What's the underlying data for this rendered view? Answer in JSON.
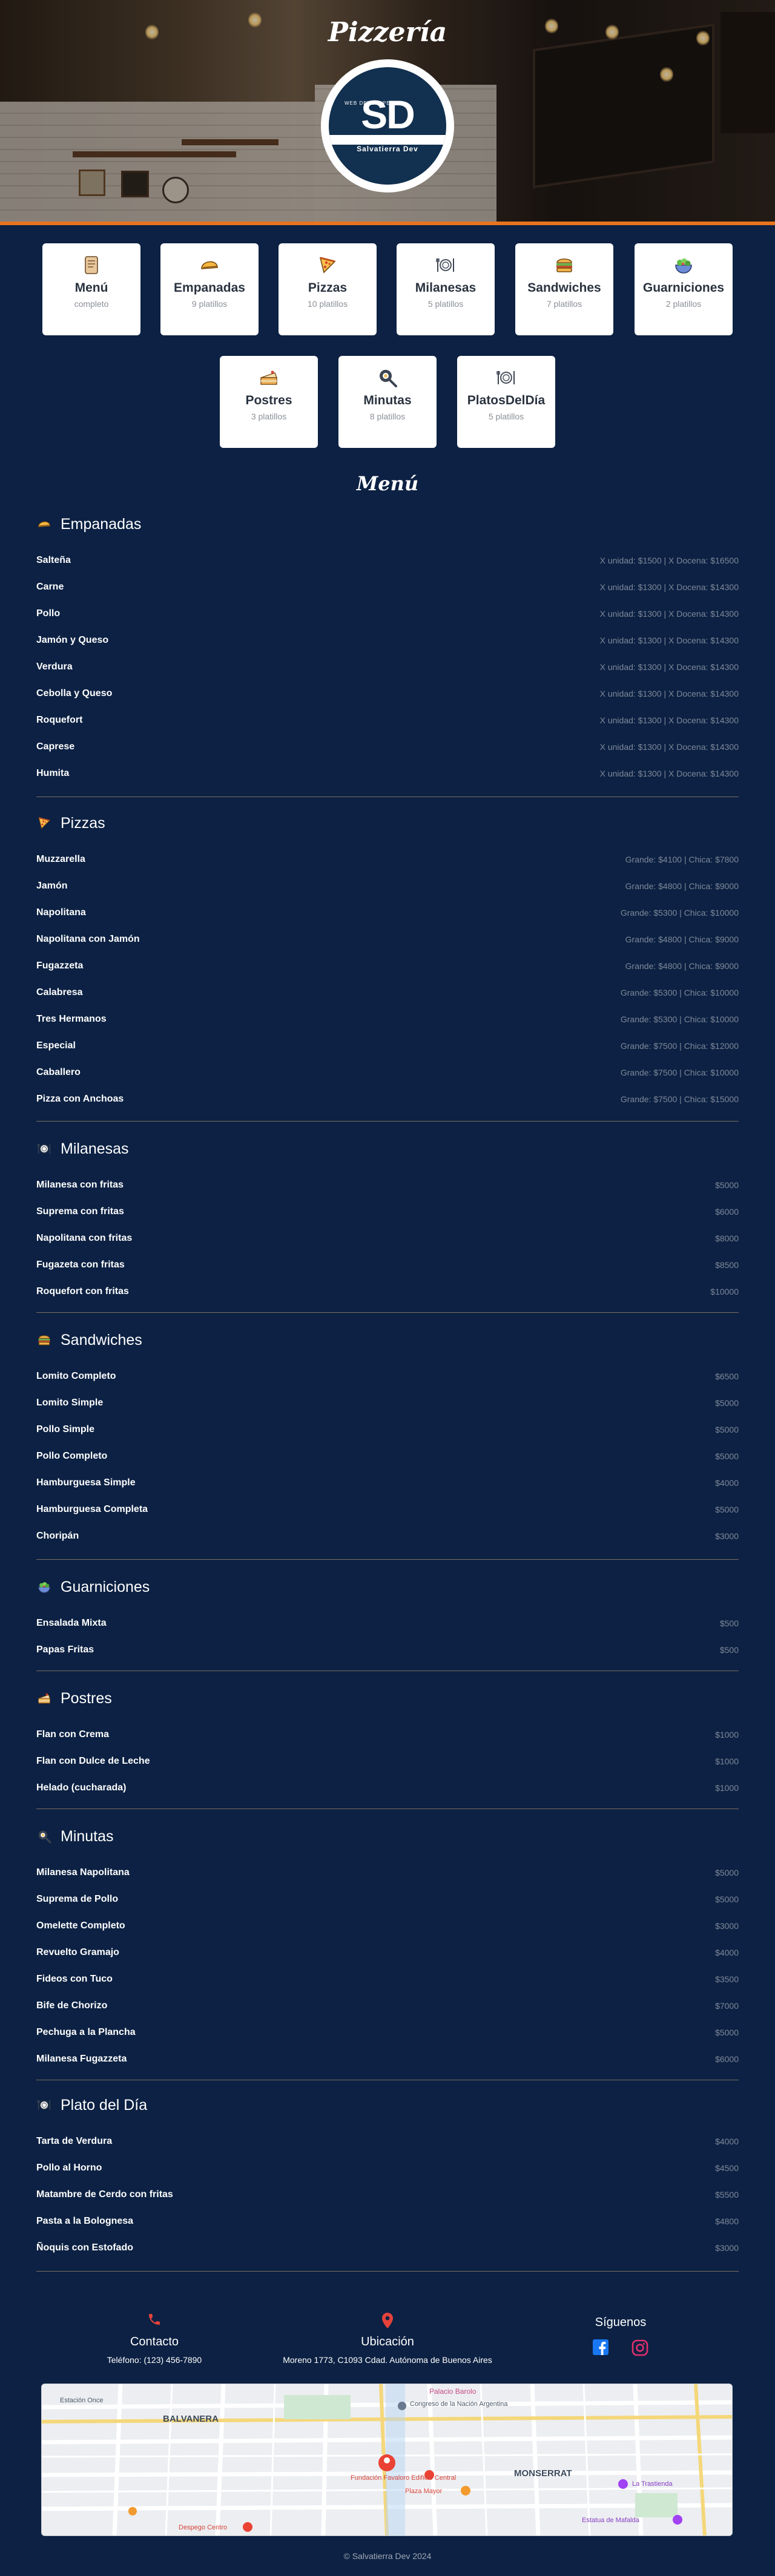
{
  "hero": {
    "title": "Pizzería"
  },
  "logo": {
    "initials": "SD",
    "tagline": "WEB DEVELOPER",
    "brand": "Salvatierra Dev"
  },
  "categories": [
    {
      "name": "Menú",
      "count": "completo",
      "icon": "scroll-icon"
    },
    {
      "name": "Empanadas",
      "count": "9 platillos",
      "icon": "empanada-icon"
    },
    {
      "name": "Pizzas",
      "count": "10 platillos",
      "icon": "pizza-icon"
    },
    {
      "name": "Milanesas",
      "count": "5 platillos",
      "icon": "plate-cutlery-icon"
    },
    {
      "name": "Sandwiches",
      "count": "7 platillos",
      "icon": "sandwich-icon"
    },
    {
      "name": "Guarniciones",
      "count": "2 platillos",
      "icon": "salad-icon"
    },
    {
      "name": "Postres",
      "count": "3 platillos",
      "icon": "cake-icon"
    },
    {
      "name": "Minutas",
      "count": "8 platillos",
      "icon": "pan-icon"
    },
    {
      "name": "PlatosDelDía",
      "count": "5 platillos",
      "icon": "plate-cutlery-icon"
    }
  ],
  "menu": {
    "title": "Menú",
    "sections": [
      {
        "title": "Empanadas",
        "icon": "empanada-icon",
        "items": [
          {
            "name": "Salteña",
            "price": "X unidad: $1500 | X Docena: $16500"
          },
          {
            "name": "Carne",
            "price": "X unidad: $1300 | X Docena: $14300"
          },
          {
            "name": "Pollo",
            "price": "X unidad: $1300 | X Docena: $14300"
          },
          {
            "name": "Jamón y Queso",
            "price": "X unidad: $1300 | X Docena: $14300"
          },
          {
            "name": "Verdura",
            "price": "X unidad: $1300 | X Docena: $14300"
          },
          {
            "name": "Cebolla y Queso",
            "price": "X unidad: $1300 | X Docena: $14300"
          },
          {
            "name": "Roquefort",
            "price": "X unidad: $1300 | X Docena: $14300"
          },
          {
            "name": "Caprese",
            "price": "X unidad: $1300 | X Docena: $14300"
          },
          {
            "name": "Humita",
            "price": "X unidad: $1300 | X Docena: $14300"
          }
        ]
      },
      {
        "title": "Pizzas",
        "icon": "pizza-icon",
        "items": [
          {
            "name": "Muzzarella",
            "price": "Grande: $4100 | Chica: $7800"
          },
          {
            "name": "Jamón",
            "price": "Grande: $4800 | Chica: $9000"
          },
          {
            "name": "Napolitana",
            "price": "Grande: $5300 | Chica: $10000"
          },
          {
            "name": "Napolitana con Jamón",
            "price": "Grande: $4800 | Chica: $9000"
          },
          {
            "name": "Fugazzeta",
            "price": "Grande: $4800 | Chica: $9000"
          },
          {
            "name": "Calabresa",
            "price": "Grande: $5300 | Chica: $10000"
          },
          {
            "name": "Tres Hermanos",
            "price": "Grande: $5300 | Chica: $10000"
          },
          {
            "name": "Especial",
            "price": "Grande: $7500 | Chica: $12000"
          },
          {
            "name": "Caballero",
            "price": "Grande: $7500 | Chica: $10000"
          },
          {
            "name": "Pizza con Anchoas",
            "price": "Grande: $7500 | Chica: $15000"
          }
        ]
      },
      {
        "title": "Milanesas",
        "icon": "plate-cutlery-icon",
        "items": [
          {
            "name": "Milanesa con fritas",
            "price": "$5000"
          },
          {
            "name": "Suprema con fritas",
            "price": "$6000"
          },
          {
            "name": "Napolitana con fritas",
            "price": "$8000"
          },
          {
            "name": "Fugazeta con fritas",
            "price": "$8500"
          },
          {
            "name": "Roquefort con fritas",
            "price": "$10000"
          }
        ]
      },
      {
        "title": "Sandwiches",
        "icon": "sandwich-icon",
        "items": [
          {
            "name": "Lomito Completo",
            "price": "$6500"
          },
          {
            "name": "Lomito Simple",
            "price": "$5000"
          },
          {
            "name": "Pollo Simple",
            "price": "$5000"
          },
          {
            "name": "Pollo Completo",
            "price": "$5000"
          },
          {
            "name": "Hamburguesa Simple",
            "price": "$4000"
          },
          {
            "name": "Hamburguesa Completa",
            "price": "$5000"
          },
          {
            "name": "Choripán",
            "price": "$3000"
          }
        ]
      },
      {
        "title": "Guarniciones",
        "icon": "salad-icon",
        "items": [
          {
            "name": "Ensalada Mixta",
            "price": "$500"
          },
          {
            "name": "Papas Fritas",
            "price": "$500"
          }
        ]
      },
      {
        "title": "Postres",
        "icon": "cake-icon",
        "items": [
          {
            "name": "Flan con Crema",
            "price": "$1000"
          },
          {
            "name": "Flan con Dulce de Leche",
            "price": "$1000"
          },
          {
            "name": "Helado (cucharada)",
            "price": "$1000"
          }
        ]
      },
      {
        "title": "Minutas",
        "icon": "pan-icon",
        "items": [
          {
            "name": "Milanesa Napolitana",
            "price": "$5000"
          },
          {
            "name": "Suprema de Pollo",
            "price": "$5000"
          },
          {
            "name": "Omelette Completo",
            "price": "$3000"
          },
          {
            "name": "Revuelto Gramajo",
            "price": "$4000"
          },
          {
            "name": "Fideos con Tuco",
            "price": "$3500"
          },
          {
            "name": "Bife de Chorizo",
            "price": "$7000"
          },
          {
            "name": "Pechuga a la Plancha",
            "price": "$5000"
          },
          {
            "name": "Milanesa Fugazzeta",
            "price": "$6000"
          }
        ]
      },
      {
        "title": "Plato del Día",
        "icon": "plate-cutlery-icon",
        "items": [
          {
            "name": "Tarta de Verdura",
            "price": "$4000"
          },
          {
            "name": "Pollo al Horno",
            "price": "$4500"
          },
          {
            "name": "Matambre de Cerdo con fritas",
            "price": "$5500"
          },
          {
            "name": "Pasta a la Bolognesa",
            "price": "$4800"
          },
          {
            "name": "Ñoquis con Estofado",
            "price": "$3000"
          }
        ]
      }
    ]
  },
  "footer": {
    "contact": {
      "title": "Contacto",
      "text": "Teléfono: (123) 456-7890",
      "icon": "phone-icon"
    },
    "location": {
      "title": "Ubicación",
      "text": "Moreno 1773, C1093 Cdad. Autónoma de Buenos Aires",
      "icon": "location-pin-icon"
    },
    "social": {
      "title": "Síguenos",
      "icons": [
        "facebook-icon",
        "instagram-icon"
      ]
    },
    "copyright": "© Salvatierra Dev 2024",
    "map_labels": {
      "balvanera": "BALVANERA",
      "monserrat": "MONSERRAT",
      "palacio": "Palacio Barolo",
      "congreso": "Congreso de la Nación Argentina",
      "fundacion": "Fundación Favaloro Edificio Central",
      "plaza": "Plaza Mayor",
      "tresmundo": "La Trastienda",
      "estacion_once": "Estación Once",
      "despegar": "Despego Centro",
      "estatua": "Estatua de Mafalda"
    }
  },
  "colors": {
    "background": "#0c2143",
    "accent": "#e8741f",
    "divider": "#7c6e63",
    "price": "#7e8899"
  }
}
